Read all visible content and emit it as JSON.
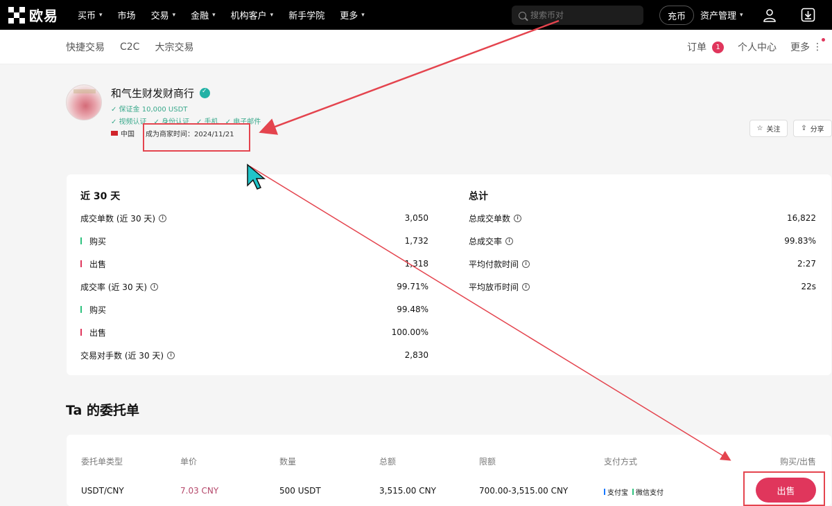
{
  "topnav": {
    "logo_text": "欧易",
    "items": [
      {
        "label": "买币",
        "chevron": true
      },
      {
        "label": "市场",
        "chevron": false
      },
      {
        "label": "交易",
        "chevron": true
      },
      {
        "label": "金融",
        "chevron": true
      },
      {
        "label": "机构客户",
        "chevron": true
      },
      {
        "label": "新手学院",
        "chevron": false
      },
      {
        "label": "更多",
        "chevron": true
      }
    ],
    "search_placeholder": "搜索币对",
    "deposit_label": "充币",
    "asset_label": "资产管理"
  },
  "subnav": {
    "left_items": [
      "快捷交易",
      "C2C",
      "大宗交易"
    ],
    "orders_label": "订单",
    "orders_badge": "1",
    "profile_label": "个人中心",
    "more_label": "更多"
  },
  "merchant": {
    "name": "和气生财发财商行",
    "deposit": "✓ 保证金 10,000 USDT",
    "verifications": [
      "✓ 视频认证",
      "✓ 身份认证",
      "✓ 手机",
      "✓ 电子邮件"
    ],
    "country": "中国",
    "since": "成为商家时间：2024/11/21",
    "follow_label": "关注",
    "share_label": "分享"
  },
  "stats": {
    "recent_title": "近 30 天",
    "total_title": "总计",
    "recent": [
      {
        "label": "成交单数 (近 30 天)",
        "value": "3,050",
        "info": true,
        "bar": ""
      },
      {
        "label": "购买",
        "value": "1,732",
        "info": false,
        "bar": "green"
      },
      {
        "label": "出售",
        "value": "1,318",
        "info": false,
        "bar": "red"
      },
      {
        "label": "成交率 (近 30 天)",
        "value": "99.71%",
        "info": true,
        "bar": ""
      },
      {
        "label": "购买",
        "value": "99.48%",
        "info": false,
        "bar": "green"
      },
      {
        "label": "出售",
        "value": "100.00%",
        "info": false,
        "bar": "red"
      },
      {
        "label": "交易对手数 (近 30 天)",
        "value": "2,830",
        "info": true,
        "bar": ""
      }
    ],
    "total": [
      {
        "label": "总成交单数",
        "value": "16,822",
        "info": true
      },
      {
        "label": "总成交率",
        "value": "99.83%",
        "info": true
      },
      {
        "label": "平均付款时间",
        "value": "2:27",
        "info": true
      },
      {
        "label": "平均放币时间",
        "value": "22s",
        "info": true
      }
    ]
  },
  "orders": {
    "title": "Ta 的委托单",
    "headers": [
      "委托单类型",
      "单价",
      "数量",
      "总额",
      "限额",
      "支付方式",
      "购买/出售"
    ],
    "row": {
      "type": "USDT/CNY",
      "price": "7.03 CNY",
      "quantity": "500 USDT",
      "total": "3,515.00 CNY",
      "limit": "700.00-3,515.00 CNY",
      "payments": [
        {
          "label": "支付宝",
          "color": "#1677ff"
        },
        {
          "label": "微信支付",
          "color": "#2ec27e"
        }
      ],
      "action": "出售"
    }
  },
  "colors": {
    "accent": "#e0365c",
    "annotation": "#e4444e",
    "verified": "#3aa98c"
  }
}
